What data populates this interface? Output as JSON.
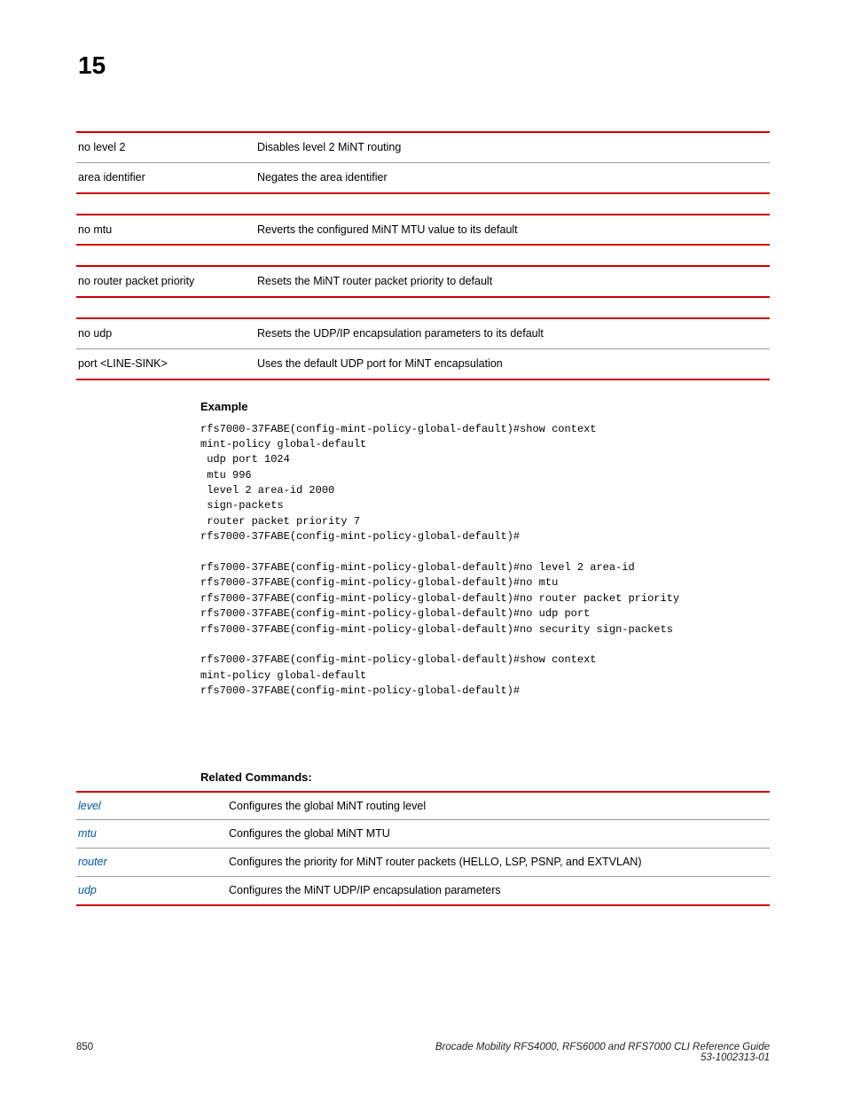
{
  "page_number": "15",
  "tables": [
    {
      "rows": [
        {
          "c0": "no level 2",
          "c1": "Disables level 2 MiNT routing"
        },
        {
          "c0": "area identifier",
          "c1": "Negates the area identifier"
        }
      ]
    },
    {
      "rows": [
        {
          "c0": "no mtu",
          "c1": "Reverts the configured MiNT MTU value to its default"
        }
      ]
    },
    {
      "rows": [
        {
          "c0": "no router packet priority",
          "c1": "Resets the MiNT router packet priority to default"
        }
      ]
    },
    {
      "rows": [
        {
          "c0": "no udp",
          "c1": "Resets the UDP/IP encapsulation parameters to its default"
        },
        {
          "c0": "port <LINE-SINK>",
          "c1": "Uses the default UDP port for MiNT encapsulation"
        }
      ]
    }
  ],
  "example_heading": "Example",
  "example_code": "rfs7000-37FABE(config-mint-policy-global-default)#show context\nmint-policy global-default\n udp port 1024\n mtu 996\n level 2 area-id 2000\n sign-packets\n router packet priority 7\nrfs7000-37FABE(config-mint-policy-global-default)#\n\nrfs7000-37FABE(config-mint-policy-global-default)#no level 2 area-id\nrfs7000-37FABE(config-mint-policy-global-default)#no mtu\nrfs7000-37FABE(config-mint-policy-global-default)#no router packet priority\nrfs7000-37FABE(config-mint-policy-global-default)#no udp port\nrfs7000-37FABE(config-mint-policy-global-default)#no security sign-packets\n\nrfs7000-37FABE(config-mint-policy-global-default)#show context\nmint-policy global-default\nrfs7000-37FABE(config-mint-policy-global-default)#",
  "related_heading": "Related Commands:",
  "related": [
    {
      "link": "level",
      "desc": "Configures the global MiNT routing level"
    },
    {
      "link": "mtu",
      "desc": "Configures the global MiNT MTU"
    },
    {
      "link": "router",
      "desc": "Configures the priority for MiNT router packets (HELLO, LSP, PSNP, and EXTVLAN)"
    },
    {
      "link": "udp",
      "desc": "Configures the MiNT UDP/IP encapsulation parameters"
    }
  ],
  "footer": {
    "page": "850",
    "title": "Brocade Mobility RFS4000, RFS6000 and RFS7000 CLI Reference Guide",
    "sub": "53-1002313-01"
  }
}
